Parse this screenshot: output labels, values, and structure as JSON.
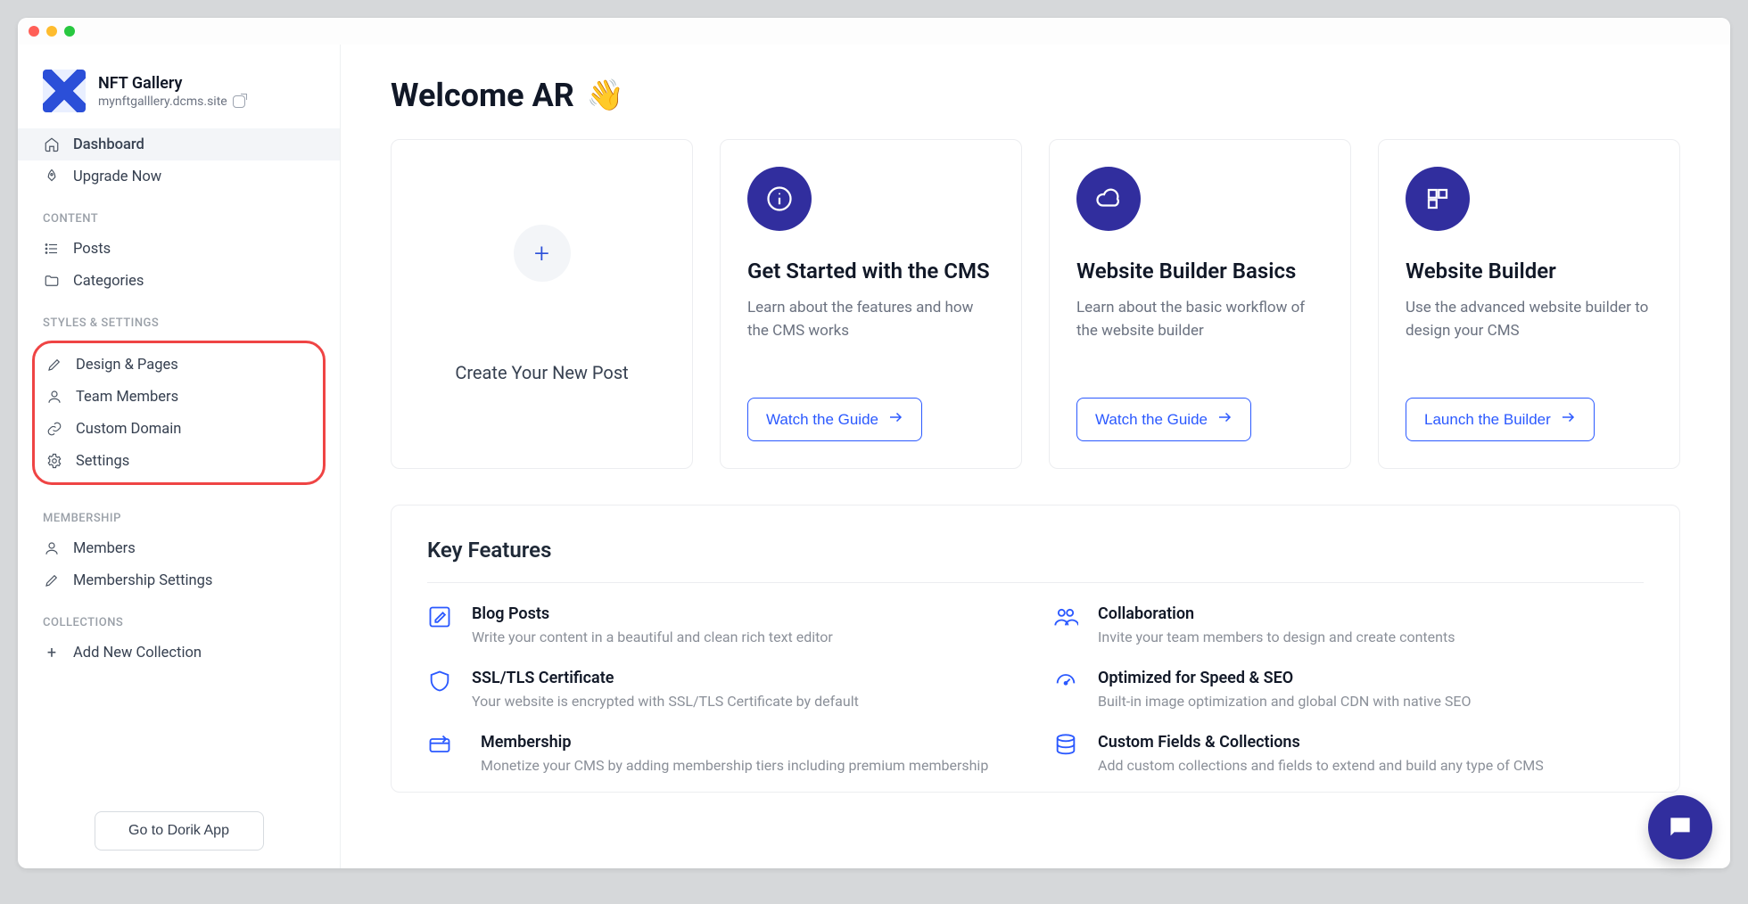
{
  "site": {
    "name": "NFT Gallery",
    "url": "mynftgalllery.dcms.site"
  },
  "nav": {
    "dashboard": "Dashboard",
    "upgrade": "Upgrade Now",
    "sections": {
      "content": "CONTENT",
      "styles": "STYLES & SETTINGS",
      "membership": "MEMBERSHIP",
      "collections": "COLLECTIONS"
    },
    "posts": "Posts",
    "categories": "Categories",
    "design": "Design & Pages",
    "team": "Team Members",
    "domain": "Custom Domain",
    "settings": "Settings",
    "members": "Members",
    "member_settings": "Membership Settings",
    "add_collection": "Add New Collection",
    "footer_button": "Go to Dorik App"
  },
  "welcome": {
    "text": "Welcome AR",
    "emoji": "👋"
  },
  "cards": {
    "new_post": "Create Your New Post",
    "cms": {
      "title": "Get Started with the CMS",
      "desc": "Learn about the features and how the CMS works",
      "cta": "Watch the Guide"
    },
    "basics": {
      "title": "Website Builder Basics",
      "desc": "Learn about the basic workflow of the website builder",
      "cta": "Watch the Guide"
    },
    "builder": {
      "title": "Website Builder",
      "desc": "Use the advanced website builder to design your CMS",
      "cta": "Launch the Builder"
    }
  },
  "features": {
    "heading": "Key Features",
    "blog": {
      "title": "Blog Posts",
      "desc": "Write your content in a beautiful and clean rich text editor"
    },
    "collab": {
      "title": "Collaboration",
      "desc": "Invite your team members to design and create contents"
    },
    "ssl": {
      "title": "SSL/TLS Certificate",
      "desc": "Your website is encrypted with SSL/TLS Certificate by default"
    },
    "speed": {
      "title": "Optimized for Speed & SEO",
      "desc": "Built-in image optimization and global CDN with native SEO"
    },
    "member": {
      "title": "Membership",
      "desc": "Monetize your CMS by adding membership tiers including premium membership"
    },
    "fields": {
      "title": "Custom Fields & Collections",
      "desc": "Add custom collections and fields to extend and build any type of CMS"
    }
  }
}
